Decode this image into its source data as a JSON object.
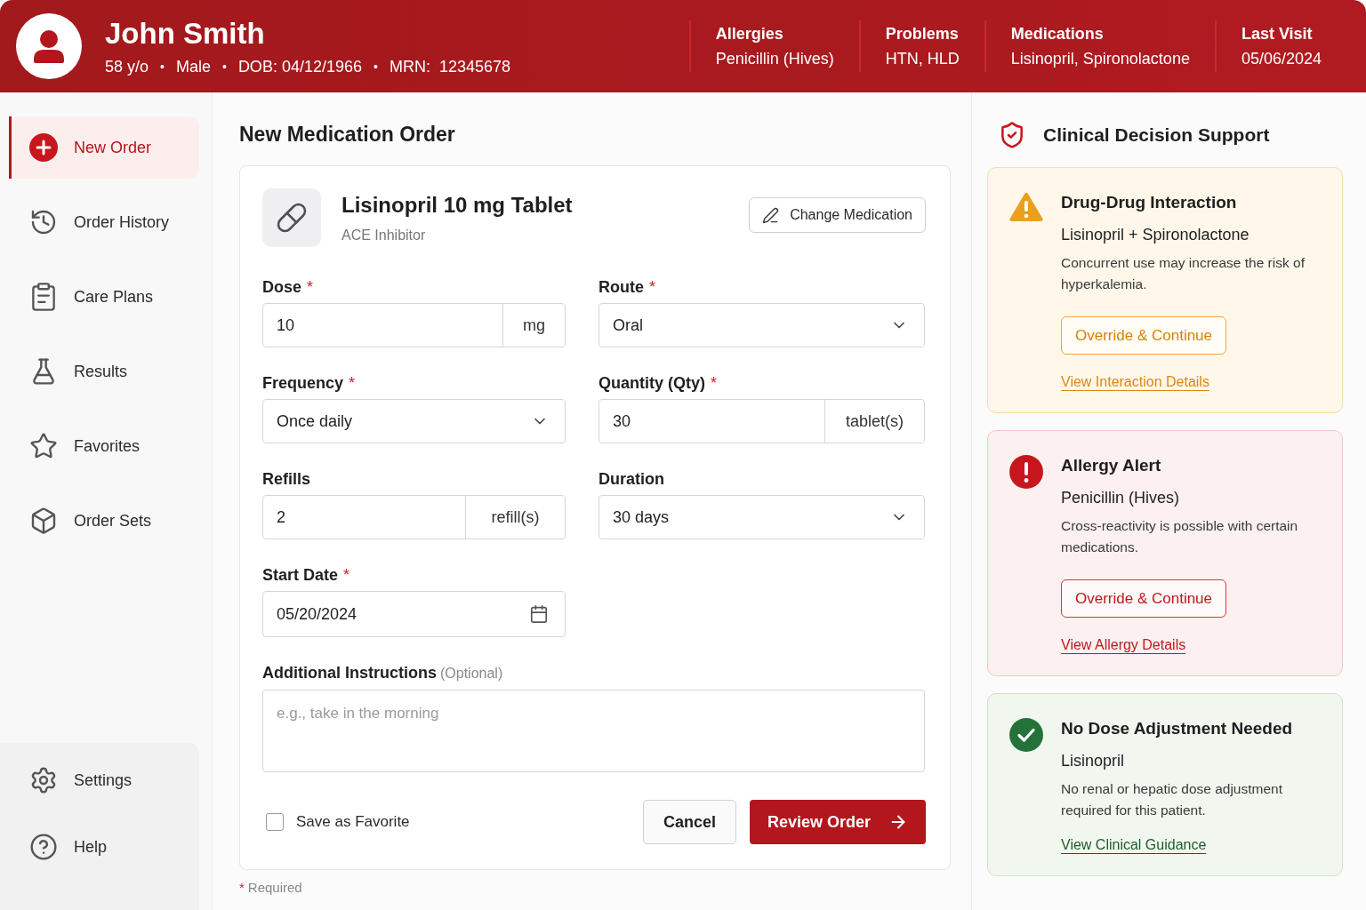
{
  "patient": {
    "name": "John Smith",
    "separator": "•",
    "details": [
      "58 y/o",
      "Male",
      "DOB: 04/12/1966",
      "MRN:  12345678"
    ],
    "summary": [
      {
        "label": "Allergies",
        "value": "Penicillin (Hives)"
      },
      {
        "label": "Problems",
        "value": "HTN, HLD"
      },
      {
        "label": "Medications",
        "value": "Lisinopril, Spironolactone"
      },
      {
        "label": "Last Visit",
        "value": "05/06/2024"
      }
    ]
  },
  "sidebar": {
    "items": [
      {
        "label": "New Order",
        "selected": true
      },
      {
        "label": "Order History",
        "selected": false
      },
      {
        "label": "Care Plans",
        "selected": false
      },
      {
        "label": "Results",
        "selected": false
      },
      {
        "label": "Favorites",
        "selected": false
      },
      {
        "label": "Order Sets",
        "selected": false
      }
    ],
    "footer_items": [
      {
        "label": "Settings",
        "selected": false
      },
      {
        "label": "Help",
        "selected": false
      }
    ]
  },
  "order": {
    "title": "New Medication Order",
    "medication": {
      "name": "Lisinopril 10 mg Tablet",
      "class": "ACE Inhibitor",
      "change_button": "Change Medication"
    },
    "required_mark": "*",
    "fields": [
      {
        "kind": "unit",
        "label": "Dose",
        "required": true,
        "value": "10",
        "unit": "mg"
      },
      {
        "kind": "select",
        "label": "Route",
        "required": true,
        "value": "Oral"
      },
      {
        "kind": "select",
        "label": "Frequency",
        "required": true,
        "value": "Once daily"
      },
      {
        "kind": "unit",
        "label": "Quantity (Qty)",
        "required": true,
        "value": "30",
        "unit": "tablet(s)"
      },
      {
        "kind": "unit",
        "label": "Refills",
        "required": false,
        "value": "2",
        "unit": "refill(s)"
      },
      {
        "kind": "select",
        "label": "Duration",
        "required": false,
        "value": "30 days"
      },
      {
        "kind": "date",
        "label": "Start Date",
        "required": true,
        "value": "05/20/2024"
      }
    ],
    "instructions": {
      "label": "Additional Instructions",
      "hint": "(Optional)",
      "placeholder": "e.g., take in the morning"
    },
    "save_favorite": {
      "label": "Save as Favorite",
      "checked": false
    },
    "cancel_button": "Cancel",
    "review_button": "Review Order",
    "required_note": "Required"
  },
  "decision_support": {
    "title": "Clinical Decision Support",
    "alerts": [
      {
        "kind": "warning",
        "title": "Drug-Drug Interaction",
        "subject": "Lisinopril + Spironolactone",
        "message": "Concurrent use may increase the risk of hyperkalemia.",
        "action": "Override & Continue",
        "link": "View Interaction Details"
      },
      {
        "kind": "danger",
        "title": "Allergy Alert",
        "subject": "Penicillin (Hives)",
        "message": "Cross-reactivity is possible with certain medications.",
        "action": "Override & Continue",
        "link": "View Allergy Details"
      },
      {
        "kind": "ok",
        "title": "No Dose Adjustment Needed",
        "subject": "Lisinopril",
        "message": "No renal or hepatic dose adjustment required for this patient.",
        "link": "View Clinical Guidance"
      }
    ]
  }
}
